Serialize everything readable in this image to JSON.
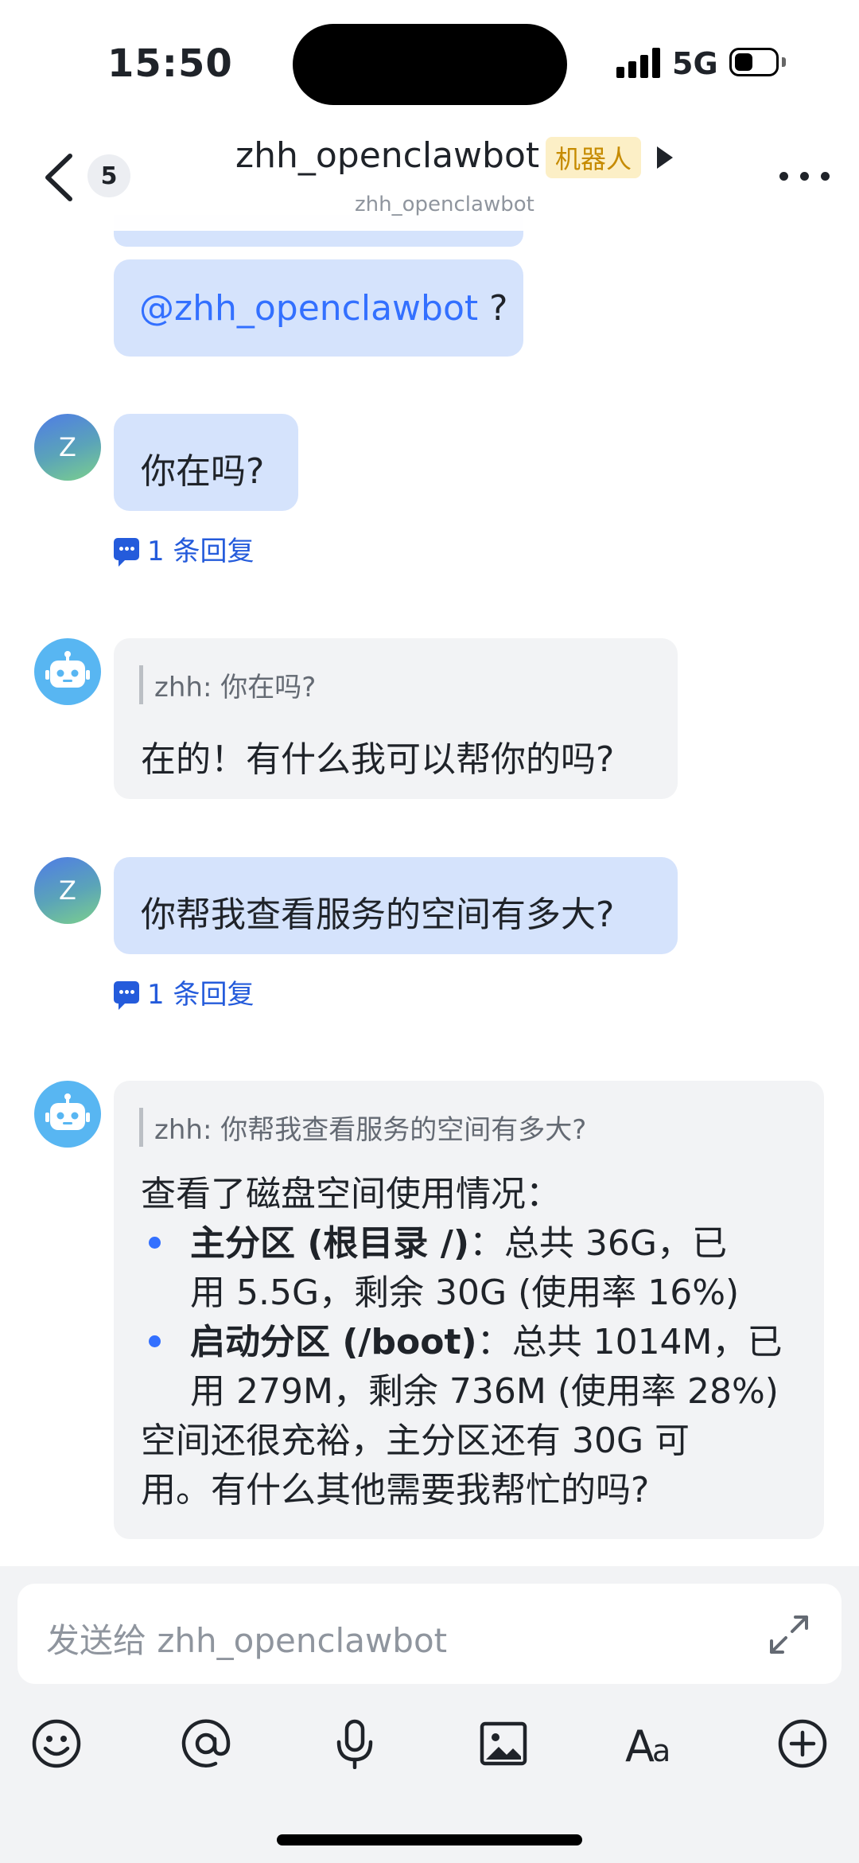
{
  "status_bar": {
    "time": "15:50",
    "network": "5G"
  },
  "header": {
    "back_icon": "chevron-left-icon",
    "unread_count": "5",
    "title": "zhh_openclawbot",
    "tag": "机器人",
    "subtitle": "zhh_openclawbot",
    "more_icon": "more-dots-icon"
  },
  "messages": [
    {
      "sender": "user",
      "mention": "@zhh_openclawbot",
      "suffix": " ?"
    },
    {
      "sender": "user",
      "avatar_letter": "Z",
      "text": "你在吗?",
      "reply": "1 条回复"
    },
    {
      "sender": "bot",
      "quote": "zhh: 你在吗?",
      "text": "在的！有什么我可以帮你的吗?"
    },
    {
      "sender": "user",
      "avatar_letter": "Z",
      "text": "你帮我查看服务的空间有多大?",
      "reply": "1 条回复"
    },
    {
      "sender": "bot",
      "quote": "zhh: 你帮我查看服务的空间有多大?",
      "intro": "查看了磁盘空间使用情况：",
      "bullets": [
        {
          "bold": "主分区 (根目录 /)",
          "line1": "：总共 36G，已",
          "line2": "用 5.5G，剩余 30G (使用率 16%)"
        },
        {
          "bold": "启动分区 (/boot)",
          "line1": "：总共 1014M，已",
          "line2": "用 279M，剩余 736M (使用率 28%)"
        }
      ],
      "outro_line1": "空间还很充裕，主分区还有 30G 可",
      "outro_line2": "用。有什么其他需要我帮忙的吗?"
    }
  ],
  "composer": {
    "placeholder": "发送给 zhh_openclawbot",
    "tools": [
      "emoji-icon",
      "mention-icon",
      "microphone-icon",
      "image-icon",
      "text-format-icon",
      "plus-icon"
    ]
  },
  "colors": {
    "accent": "#3370ff",
    "user_bubble": "#d5e3fc",
    "bot_bubble": "#f2f3f5",
    "bot_tag_bg": "#fcefc6"
  }
}
